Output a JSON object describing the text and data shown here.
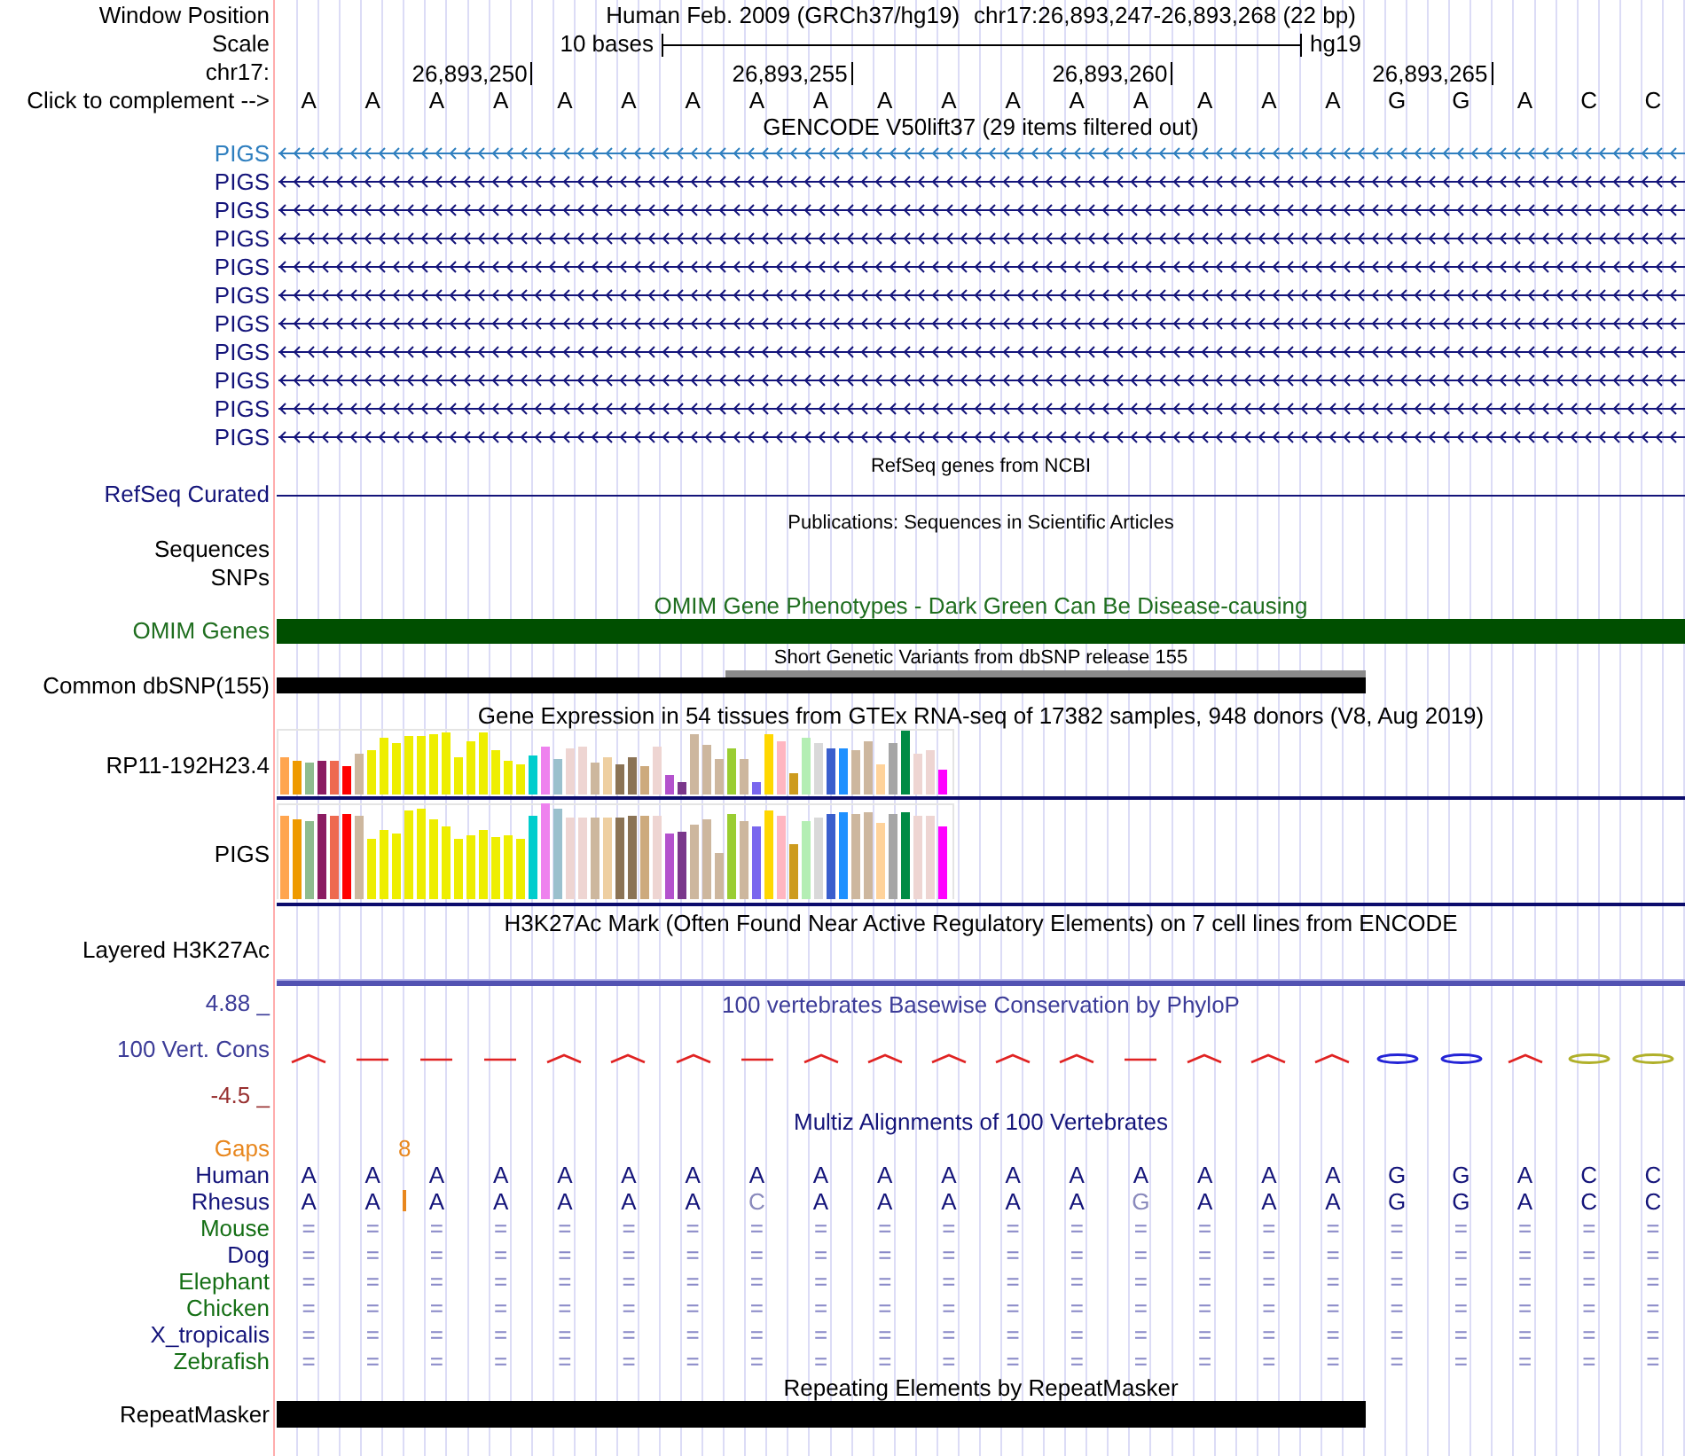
{
  "window_position": {
    "label": "Window Position",
    "assembly": "Human Feb. 2009 (GRCh37/hg19)",
    "region": "chr17:26,893,247-26,893,268 (22 bp)"
  },
  "scale": {
    "label": "Scale",
    "length": "10 bases",
    "database": "hg19"
  },
  "ruler": {
    "label": "chr17:",
    "ticks": [
      "26,893,250",
      "26,893,255",
      "26,893,260",
      "26,893,265"
    ]
  },
  "sequence": {
    "label": "Click to complement -->",
    "bases": [
      "A",
      "A",
      "A",
      "A",
      "A",
      "A",
      "A",
      "A",
      "A",
      "A",
      "A",
      "A",
      "A",
      "A",
      "A",
      "A",
      "A",
      "G",
      "G",
      "A",
      "C",
      "C"
    ]
  },
  "tracks": [
    {
      "kind": "genes",
      "title": "GENCODE V50lift37 (29 items filtered out)",
      "items": [
        {
          "name": "PIGS",
          "color": "#2f7fbf"
        },
        {
          "name": "PIGS",
          "color": "#14147a"
        },
        {
          "name": "PIGS",
          "color": "#14147a"
        },
        {
          "name": "PIGS",
          "color": "#14147a"
        },
        {
          "name": "PIGS",
          "color": "#14147a"
        },
        {
          "name": "PIGS",
          "color": "#14147a"
        },
        {
          "name": "PIGS",
          "color": "#14147a"
        },
        {
          "name": "PIGS",
          "color": "#14147a"
        },
        {
          "name": "PIGS",
          "color": "#14147a"
        },
        {
          "name": "PIGS",
          "color": "#14147a"
        },
        {
          "name": "PIGS",
          "color": "#14147a"
        }
      ]
    },
    {
      "kind": "line",
      "title": "RefSeq genes from NCBI",
      "label": "RefSeq Curated"
    },
    {
      "kind": "note",
      "title": "Publications: Sequences in Scientific Articles",
      "label": "Sequences"
    },
    {
      "kind": "label",
      "label": "SNPs"
    },
    {
      "kind": "phenotype",
      "title": "OMIM Gene Phenotypes - Dark Green Can Be Disease-causing",
      "label": "OMIM Genes"
    },
    {
      "kind": "variants",
      "title": "Short Genetic Variants from dbSNP release 155",
      "label": "Common dbSNP(155)"
    },
    {
      "kind": "expression",
      "title": "Gene Expression in 54 tissues from GTEx RNA-seq of 17382 samples, 948 donors (V8, Aug 2019)",
      "genes": [
        {
          "name": "RP11-192H23.4"
        },
        {
          "name": "PIGS"
        }
      ]
    },
    {
      "kind": "signal",
      "title": "H3K27Ac Mark (Often Found Near Active Regulatory Elements) on 7 cell lines from ENCODE",
      "label": "Layered H3K27Ac"
    },
    {
      "kind": "conservation",
      "title": "100 vertebrates Basewise Conservation by PhyloP",
      "label": "100 Vert. Cons",
      "max": "4.88 _",
      "min": "-4.5 _"
    },
    {
      "kind": "alignment",
      "title": "Multiz Alignments of 100 Vertebrates",
      "gaps": {
        "label": "Gaps",
        "counts": [
          "8"
        ]
      },
      "species": [
        {
          "name": "Human",
          "color": "#14147a",
          "kind": "reference",
          "bases": [
            "A",
            "A",
            "A",
            "A",
            "A",
            "A",
            "A",
            "A",
            "A",
            "A",
            "A",
            "A",
            "A",
            "A",
            "A",
            "A",
            "A",
            "G",
            "G",
            "A",
            "C",
            "C"
          ]
        },
        {
          "name": "Rhesus",
          "color": "#14147a",
          "kind": "aligned",
          "cells": [
            {
              "base": "A",
              "differs": false,
              "insertion": false
            },
            {
              "base": "A",
              "differs": false,
              "insertion": true
            },
            {
              "base": "A",
              "differs": false,
              "insertion": false
            },
            {
              "base": "A",
              "differs": false,
              "insertion": false
            },
            {
              "base": "A",
              "differs": false,
              "insertion": false
            },
            {
              "base": "A",
              "differs": false,
              "insertion": false
            },
            {
              "base": "A",
              "differs": false,
              "insertion": false
            },
            {
              "base": "C",
              "differs": true,
              "insertion": false
            },
            {
              "base": "A",
              "differs": false,
              "insertion": false
            },
            {
              "base": "A",
              "differs": false,
              "insertion": false
            },
            {
              "base": "A",
              "differs": false,
              "insertion": false
            },
            {
              "base": "A",
              "differs": false,
              "insertion": false
            },
            {
              "base": "A",
              "differs": false,
              "insertion": false
            },
            {
              "base": "G",
              "differs": true,
              "insertion": false
            },
            {
              "base": "A",
              "differs": false,
              "insertion": false
            },
            {
              "base": "A",
              "differs": false,
              "insertion": false
            },
            {
              "base": "A",
              "differs": false,
              "insertion": false
            },
            {
              "base": "G",
              "differs": false,
              "insertion": false
            },
            {
              "base": "G",
              "differs": false,
              "insertion": false
            },
            {
              "base": "A",
              "differs": false,
              "insertion": false
            },
            {
              "base": "C",
              "differs": false,
              "insertion": false
            },
            {
              "base": "C",
              "differs": false,
              "insertion": false
            }
          ]
        },
        {
          "name": "Mouse",
          "color": "#156f15",
          "kind": "unaligned",
          "marks": [
            "=",
            "=",
            "=",
            "=",
            "=",
            "=",
            "=",
            "=",
            "=",
            "=",
            "=",
            "=",
            "=",
            "=",
            "=",
            "=",
            "=",
            "=",
            "=",
            "=",
            "=",
            "="
          ]
        },
        {
          "name": "Dog",
          "color": "#14147a",
          "kind": "unaligned",
          "marks": [
            "=",
            "=",
            "=",
            "=",
            "=",
            "=",
            "=",
            "=",
            "=",
            "=",
            "=",
            "=",
            "=",
            "=",
            "=",
            "=",
            "=",
            "=",
            "=",
            "=",
            "=",
            "="
          ]
        },
        {
          "name": "Elephant",
          "color": "#156f15",
          "kind": "unaligned",
          "marks": [
            "=",
            "=",
            "=",
            "=",
            "=",
            "=",
            "=",
            "=",
            "=",
            "=",
            "=",
            "=",
            "=",
            "=",
            "=",
            "=",
            "=",
            "=",
            "=",
            "=",
            "=",
            "="
          ]
        },
        {
          "name": "Chicken",
          "color": "#156f15",
          "kind": "unaligned",
          "marks": [
            "=",
            "=",
            "=",
            "=",
            "=",
            "=",
            "=",
            "=",
            "=",
            "=",
            "=",
            "=",
            "=",
            "=",
            "=",
            "=",
            "=",
            "=",
            "=",
            "=",
            "=",
            "="
          ]
        },
        {
          "name": "X_tropicalis",
          "color": "#14147a",
          "kind": "unaligned",
          "marks": [
            "=",
            "=",
            "=",
            "=",
            "=",
            "=",
            "=",
            "=",
            "=",
            "=",
            "=",
            "=",
            "=",
            "=",
            "=",
            "=",
            "=",
            "=",
            "=",
            "=",
            "=",
            "="
          ]
        },
        {
          "name": "Zebrafish",
          "color": "#156f15",
          "kind": "unaligned",
          "marks": [
            "=",
            "=",
            "=",
            "=",
            "=",
            "=",
            "=",
            "=",
            "=",
            "=",
            "=",
            "=",
            "=",
            "=",
            "=",
            "=",
            "=",
            "=",
            "=",
            "=",
            "=",
            "="
          ]
        }
      ]
    },
    {
      "kind": "repeats",
      "title": "Repeating Elements by RepeatMasker",
      "label": "RepeatMasker"
    }
  ]
}
